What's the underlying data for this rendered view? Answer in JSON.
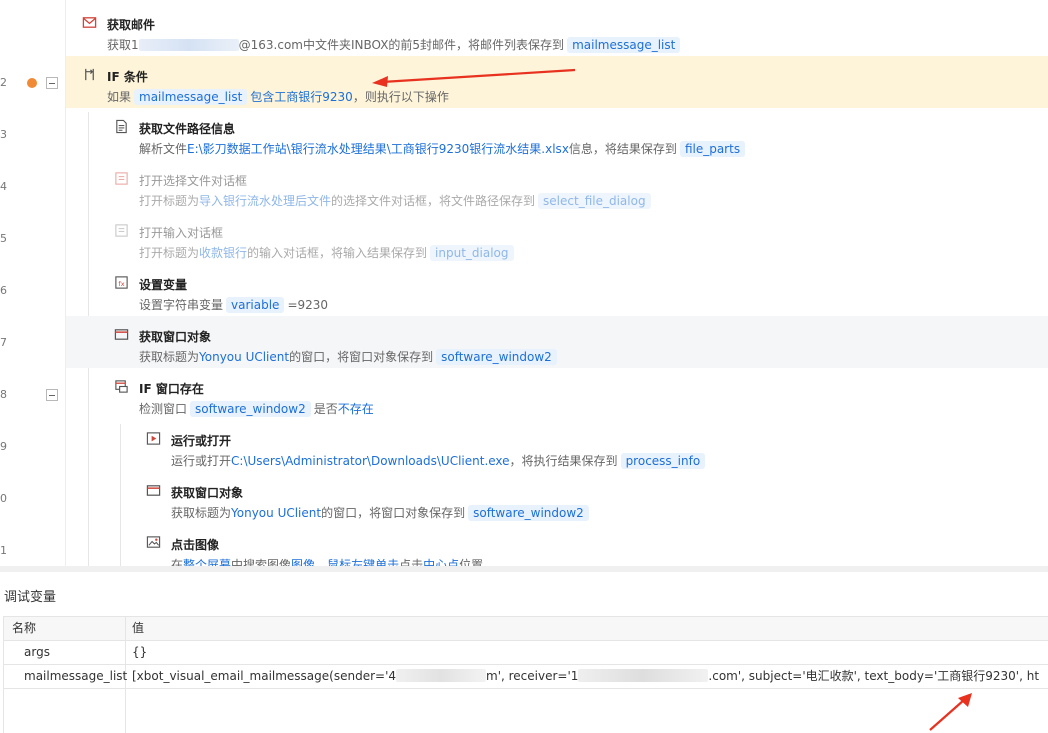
{
  "gutter": {
    "line_numbers": [
      "2",
      "3",
      "4",
      "5",
      "6",
      "7",
      "8",
      "9",
      "0",
      "1"
    ]
  },
  "steps": [
    {
      "title": "获取邮件",
      "desc_prefix": "获取1",
      "desc_mid": "@163.com中文件夹INBOX的前5封邮件，将邮件列表保存到",
      "tag": "mailmessage_list"
    },
    {
      "title": "IF 条件",
      "desc_prefix": "如果",
      "tag": "mailmessage_list",
      "desc_link": "包含工商银行9230",
      "desc_suffix": "，则执行以下操作"
    },
    {
      "title": "获取文件路径信息",
      "desc_prefix": "解析文件",
      "desc_link": "E:\\影刀数据工作站\\银行流水处理结果\\工商银行9230银行流水结果.xlsx",
      "desc_mid": "信息，将结果保存到",
      "tag": "file_parts"
    },
    {
      "title": "打开选择文件对话框",
      "desc_prefix": "打开标题为",
      "desc_link": "导入银行流水处理后文件",
      "desc_mid": "的选择文件对话框，将文件路径保存到",
      "tag": "select_file_dialog"
    },
    {
      "title": "打开输入对话框",
      "desc_prefix": "打开标题为",
      "desc_link": "收款银行",
      "desc_mid": "的输入对话框，将输入结果保存到",
      "tag": "input_dialog"
    },
    {
      "title": "设置变量",
      "desc_prefix": "设置字符串变量",
      "tag": "variable",
      "desc_suffix": "=9230"
    },
    {
      "title": "获取窗口对象",
      "desc_prefix": "获取标题为",
      "desc_link": "Yonyou UClient",
      "desc_mid": "的窗口，将窗口对象保存到",
      "tag": "software_window2"
    },
    {
      "title": "IF 窗口存在",
      "desc_prefix": "检测窗口",
      "tag": "software_window2",
      "desc_mid": "是否",
      "desc_link": "不存在"
    },
    {
      "title": "运行或打开",
      "desc_prefix": "运行或打开",
      "desc_link": "C:\\Users\\Administrator\\Downloads\\UClient.exe",
      "desc_mid": "，将执行结果保存到",
      "tag": "process_info"
    },
    {
      "title": "获取窗口对象",
      "desc_prefix": "获取标题为",
      "desc_link": "Yonyou UClient",
      "desc_mid": "的窗口，将窗口对象保存到",
      "tag": "software_window2"
    },
    {
      "title": "点击图像",
      "desc_prefix": "在",
      "desc_link": "整个屏幕",
      "desc_mid": "中搜索图像",
      "desc_link2": "图像",
      "desc_mid2": "，",
      "desc_link3": "鼠标左键单击",
      "desc_mid3": "点击",
      "desc_link4": "中心点",
      "desc_suffix": "位置"
    }
  ],
  "debug": {
    "title": "调试变量",
    "columns": [
      "名称",
      "值"
    ],
    "rows": [
      {
        "name": "args",
        "value": "{}"
      },
      {
        "name": "mailmessage_list",
        "value_a": "[xbot_visual_email_mailmessage(sender='4",
        "value_b": "m', receiver='1",
        "value_c": ".com', subject='电汇收款', text_body='工商银行9230', ht"
      }
    ]
  },
  "colors": {
    "highlight_row": "#fdf4d9",
    "link": "#1c6fd8",
    "tag_bg": "#e8f2fd",
    "breakpoint": "#f08a37",
    "annotation_arrow": "#e8311f"
  }
}
